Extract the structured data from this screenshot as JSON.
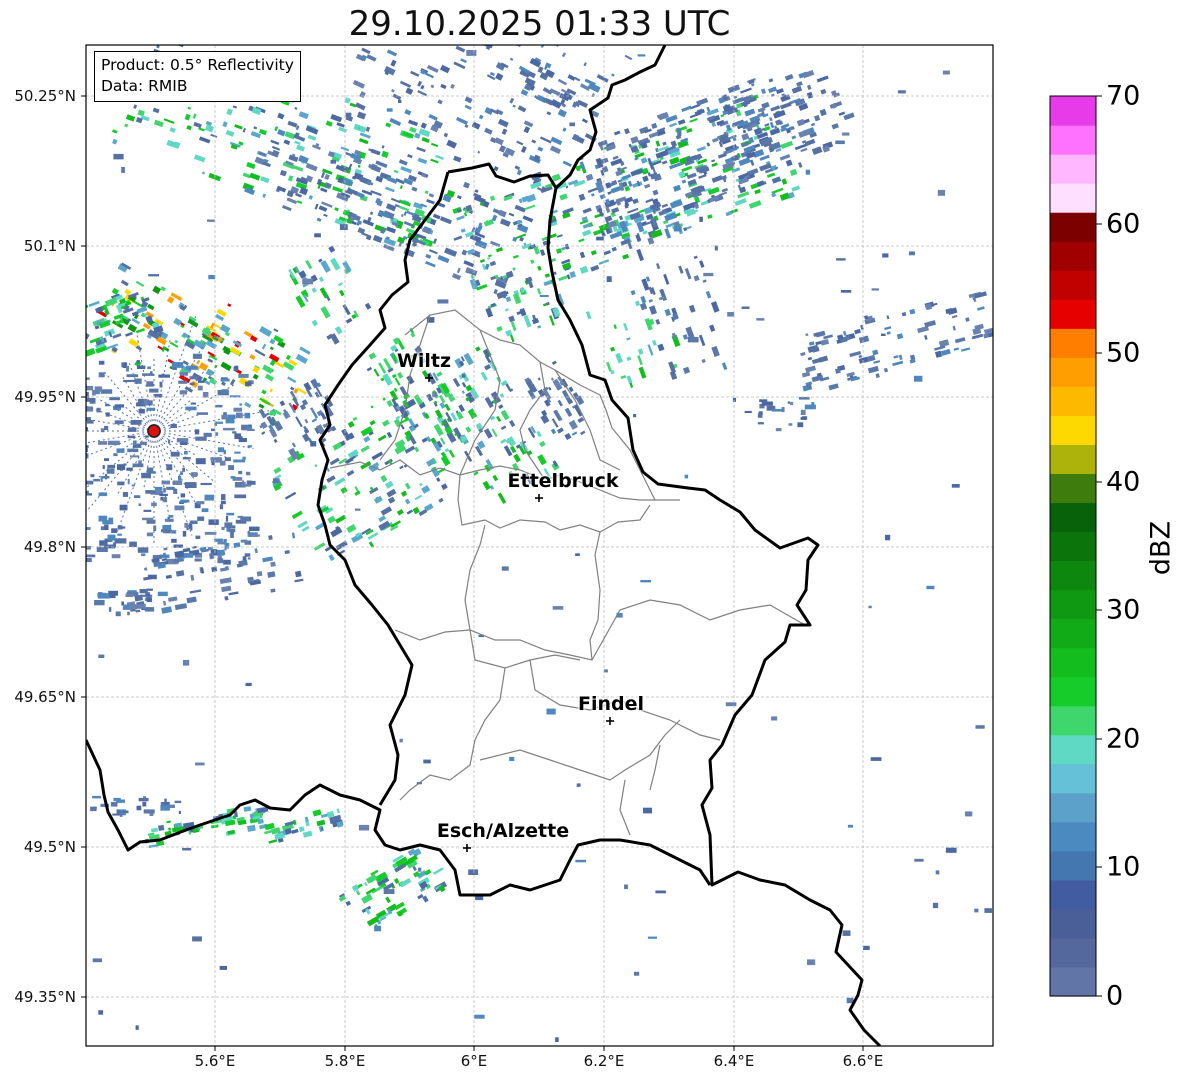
{
  "title": "29.10.2025 01:33 UTC",
  "info": {
    "product": "Product: 0.5° Reflectivity",
    "data_source": "Data: RMIB"
  },
  "axes": {
    "lon_ticks": [
      "5.6°E",
      "5.8°E",
      "6°E",
      "6.2°E",
      "6.4°E",
      "6.6°E"
    ],
    "lat_ticks": [
      "50.25°N",
      "50.1°N",
      "49.95°N",
      "49.8°N",
      "49.65°N",
      "49.5°N",
      "49.35°N"
    ]
  },
  "cities": [
    {
      "name": "Wiltz"
    },
    {
      "name": "Ettelbruck"
    },
    {
      "name": "Findel"
    },
    {
      "name": "Esch/Alzette"
    }
  ],
  "colorbar": {
    "label": "dBZ",
    "ticks": [
      "0",
      "10",
      "20",
      "30",
      "40",
      "50",
      "60",
      "70"
    ],
    "min": 0,
    "max": 70,
    "colors": [
      "#6175a6",
      "#55689e",
      "#4a5e98",
      "#425ca1",
      "#4477b0",
      "#4b8ac0",
      "#5ba1c9",
      "#65c1d7",
      "#5fd8c4",
      "#3fd66e",
      "#16cc2a",
      "#12bd1d",
      "#10ab16",
      "#0f9912",
      "#0e870f",
      "#0b750c",
      "#08620a",
      "#3f7c0e",
      "#aeb30b",
      "#fed801",
      "#fdb800",
      "#ff9e00",
      "#ff7e00",
      "#e60000",
      "#c10000",
      "#a00000",
      "#7d0000",
      "#ffdfff",
      "#ffb7ff",
      "#ff72ff",
      "#e73ae9"
    ]
  },
  "radar_site": {
    "color": "#e01010"
  }
}
